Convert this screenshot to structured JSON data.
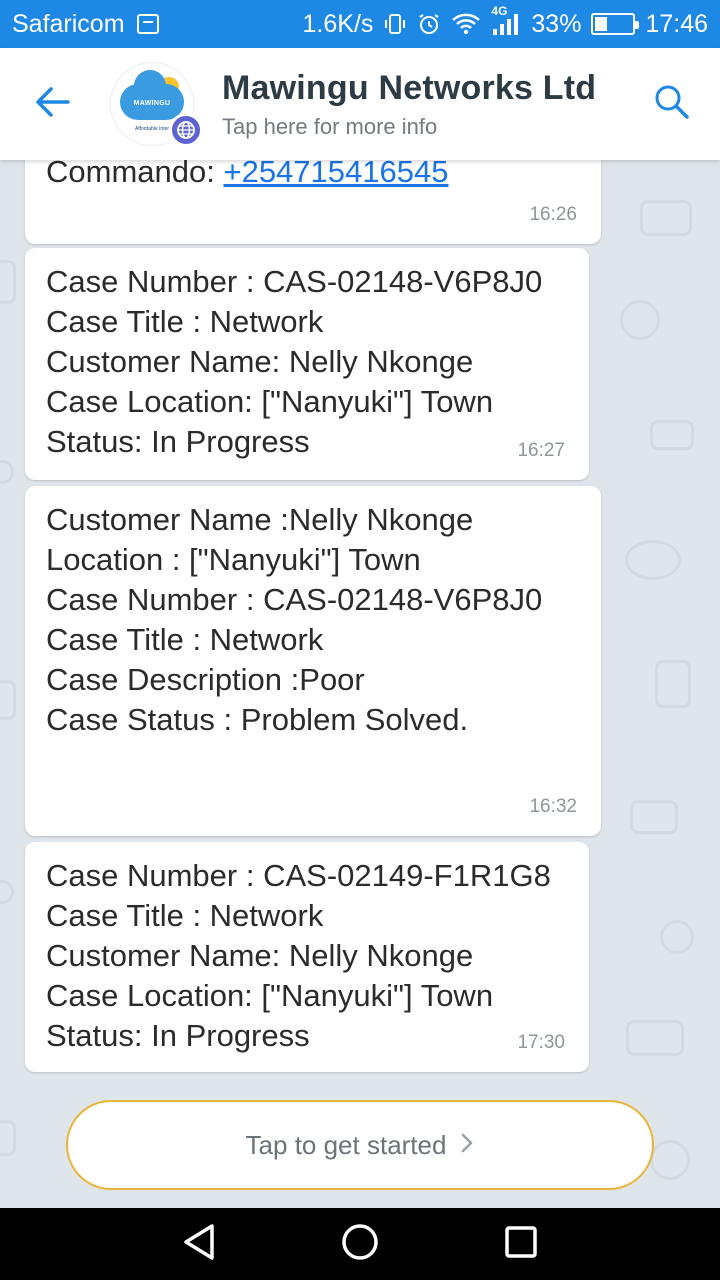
{
  "status_bar": {
    "carrier": "Safaricom",
    "speed": "1.6K/s",
    "network": "4G",
    "battery": "33%",
    "battery_level": 0.33,
    "time": "17:46"
  },
  "header": {
    "title": "Mawingu Networks Ltd",
    "subtitle": "Tap here for more info",
    "avatar_brand": "MAWINGU",
    "avatar_tagline": "Affordable Inter"
  },
  "messages": [
    {
      "lines": [
        "Commando: "
      ],
      "link": "+254715416545",
      "time": "16:26"
    },
    {
      "lines": [
        "Case Number : CAS-02148-V6P8J0",
        "Case Title : Network",
        "Customer Name: Nelly Nkonge",
        "Case Location: [\"Nanyuki\"] Town",
        "Status: In Progress"
      ],
      "time": "16:27"
    },
    {
      "lines": [
        "Customer Name :Nelly Nkonge",
        "Location : [\"Nanyuki\"] Town",
        "Case Number : CAS-02148-V6P8J0",
        "Case Title : Network",
        "Case Description :Poor",
        "Case Status : Problem Solved."
      ],
      "time": "16:32"
    },
    {
      "lines": [
        "Case Number : CAS-02149-F1R1G8",
        "Case Title : Network",
        "Customer Name: Nelly Nkonge",
        "Case Location: [\"Nanyuki\"] Town",
        "Status: In Progress"
      ],
      "time": "17:30"
    }
  ],
  "get_started": {
    "label": "Tap to get started"
  },
  "icons": {
    "back": "arrow-left-icon",
    "search": "search-icon",
    "globe": "globe-icon",
    "nav_back": "triangle-back-icon",
    "nav_home": "circle-home-icon",
    "nav_recents": "square-recents-icon"
  },
  "colors": {
    "status_bar": "#1e88e5",
    "accent": "#1e88e5",
    "chat_bg": "#dfe6eb",
    "button_border": "#e8b53a",
    "link": "#1a73e8"
  }
}
